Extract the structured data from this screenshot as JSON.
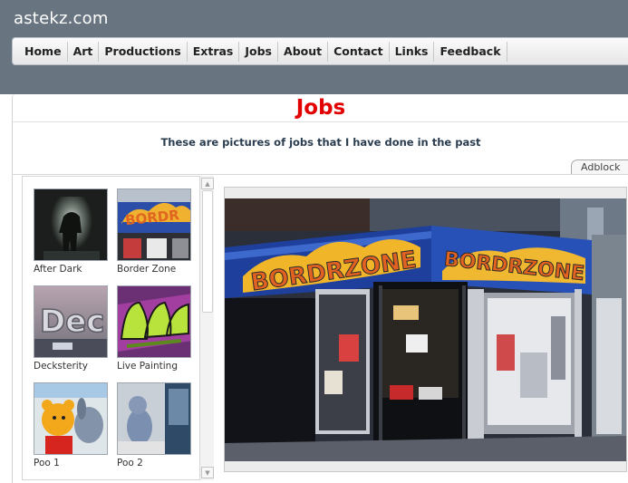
{
  "site": {
    "title": "astekz.com"
  },
  "nav": {
    "items": [
      {
        "label": "Home"
      },
      {
        "label": "Art"
      },
      {
        "label": "Productions"
      },
      {
        "label": "Extras"
      },
      {
        "label": "Jobs"
      },
      {
        "label": "About"
      },
      {
        "label": "Contact"
      },
      {
        "label": "Links"
      },
      {
        "label": "Feedback"
      }
    ]
  },
  "page": {
    "heading": "Jobs",
    "subtitle": "These are pictures of jobs that I have done in the past",
    "heading_color": "#e30000"
  },
  "adblock": {
    "label": "Adblock"
  },
  "gallery": {
    "thumbnails": [
      {
        "label": "After Dark"
      },
      {
        "label": "Border Zone"
      },
      {
        "label": "Decksterity"
      },
      {
        "label": "Live Painting"
      },
      {
        "label": "Poo 1"
      },
      {
        "label": "Poo 2"
      }
    ],
    "selected": "Border Zone"
  },
  "colors": {
    "header_bg": "#687580",
    "accent": "#e30000"
  }
}
